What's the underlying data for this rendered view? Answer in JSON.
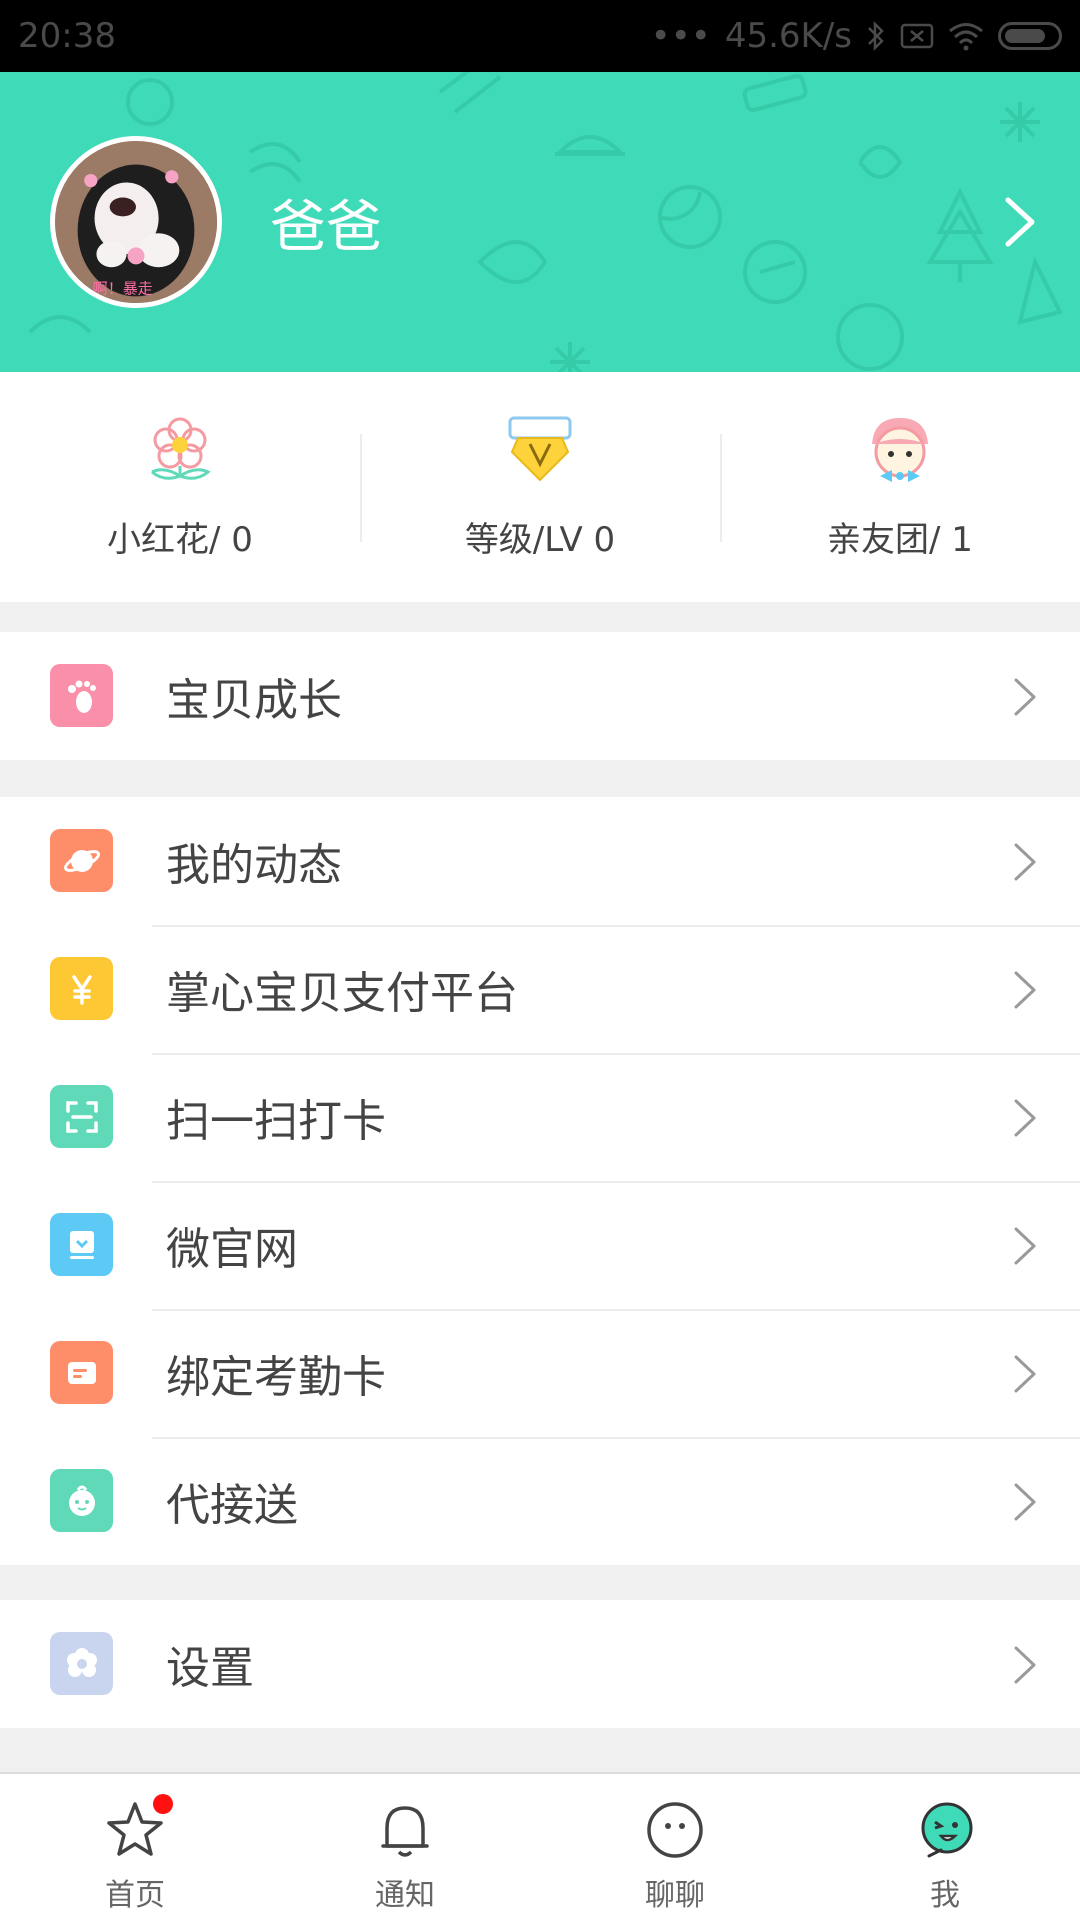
{
  "status_bar": {
    "time": "20:38",
    "network_speed": "45.6K/s",
    "icons": [
      "dots-icon",
      "bluetooth-icon",
      "sim-icon",
      "wifi-icon",
      "battery-icon"
    ]
  },
  "header": {
    "username": "爸爸",
    "avatar_caption": "啊！暴走",
    "background_color": "#3fdbb8"
  },
  "stats": [
    {
      "label": "小红花/ 0",
      "icon": "flower-icon"
    },
    {
      "label": "等级/LV 0",
      "icon": "diamond-badge-icon"
    },
    {
      "label": "亲友团/ 1",
      "icon": "kid-face-icon"
    }
  ],
  "menu": {
    "group1": [
      {
        "label": "宝贝成长",
        "icon": "footprint-icon",
        "color": "#f98fa8"
      }
    ],
    "group2": [
      {
        "label": "我的动态",
        "icon": "planet-icon",
        "color": "#fe8d6a"
      },
      {
        "label": "掌心宝贝支付平台",
        "icon": "yen-icon",
        "color": "#fdc833"
      },
      {
        "label": "扫一扫打卡",
        "icon": "scan-icon",
        "color": "#5fd9b8"
      },
      {
        "label": "微官网",
        "icon": "monitor-icon",
        "color": "#5ccaf4"
      },
      {
        "label": "绑定考勤卡",
        "icon": "card-icon",
        "color": "#fe8d6a"
      },
      {
        "label": "代接送",
        "icon": "baby-face-icon",
        "color": "#5fd9b8"
      }
    ],
    "group3": [
      {
        "label": "设置",
        "icon": "gear-icon",
        "color": "#c9d5ee"
      }
    ]
  },
  "tab_bar": [
    {
      "label": "首页",
      "icon": "star-icon",
      "badge": true
    },
    {
      "label": "通知",
      "icon": "bell-icon",
      "badge": false
    },
    {
      "label": "聊聊",
      "icon": "chat-face-icon",
      "badge": false
    },
    {
      "label": "我",
      "icon": "me-face-icon",
      "badge": false
    }
  ]
}
